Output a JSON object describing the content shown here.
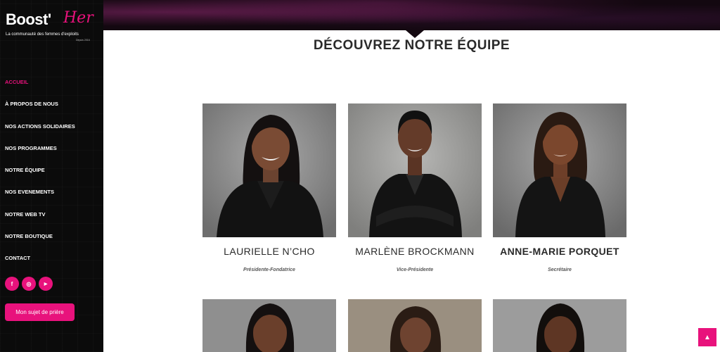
{
  "brand": {
    "logo_main": "Boost'",
    "logo_script": "Her",
    "tagline": "La communauté des femmes d'exploits",
    "small": "Depuis 2016"
  },
  "nav": {
    "items": [
      {
        "label": "ACCUEIL",
        "active": true
      },
      {
        "label": "À PROPOS DE NOUS",
        "active": false
      },
      {
        "label": "NOS ACTIONS SOLIDAIRES",
        "active": false
      },
      {
        "label": "NOS PROGRAMMES",
        "active": false
      },
      {
        "label": "NOTRE ÉQUIPE",
        "active": false
      },
      {
        "label": "NOS EVENEMENTS",
        "active": false
      },
      {
        "label": "NOTRE WEB TV",
        "active": false
      },
      {
        "label": "NOTRE BOUTIQUE",
        "active": false
      },
      {
        "label": "CONTACT",
        "active": false
      }
    ]
  },
  "socials": [
    {
      "icon": "facebook-icon",
      "glyph": "f"
    },
    {
      "icon": "instagram-icon",
      "glyph": "◎"
    },
    {
      "icon": "youtube-icon",
      "glyph": "▶"
    }
  ],
  "prayer_button": "Mon sujet de prière",
  "section": {
    "title": "DÉCOUVREZ NOTRE ÉQUIPE"
  },
  "team": [
    {
      "name": "LAURIELLE N’CHO",
      "role": "Présidente-Fondatrice",
      "bold": false
    },
    {
      "name": "MARLÈNE BROCKMANN",
      "role": "Vice-Présidente",
      "bold": false
    },
    {
      "name": "ANNE-MARIE PORQUET",
      "role": "Secrétaire",
      "bold": true
    },
    {
      "name": "",
      "role": "",
      "bold": false
    },
    {
      "name": "",
      "role": "",
      "bold": false
    },
    {
      "name": "",
      "role": "",
      "bold": false
    }
  ],
  "colors": {
    "accent": "#e8127c",
    "sidebar": "#0b0b0b",
    "text": "#2a2a2a"
  },
  "scroll_top_icon": "chevron-up-icon"
}
